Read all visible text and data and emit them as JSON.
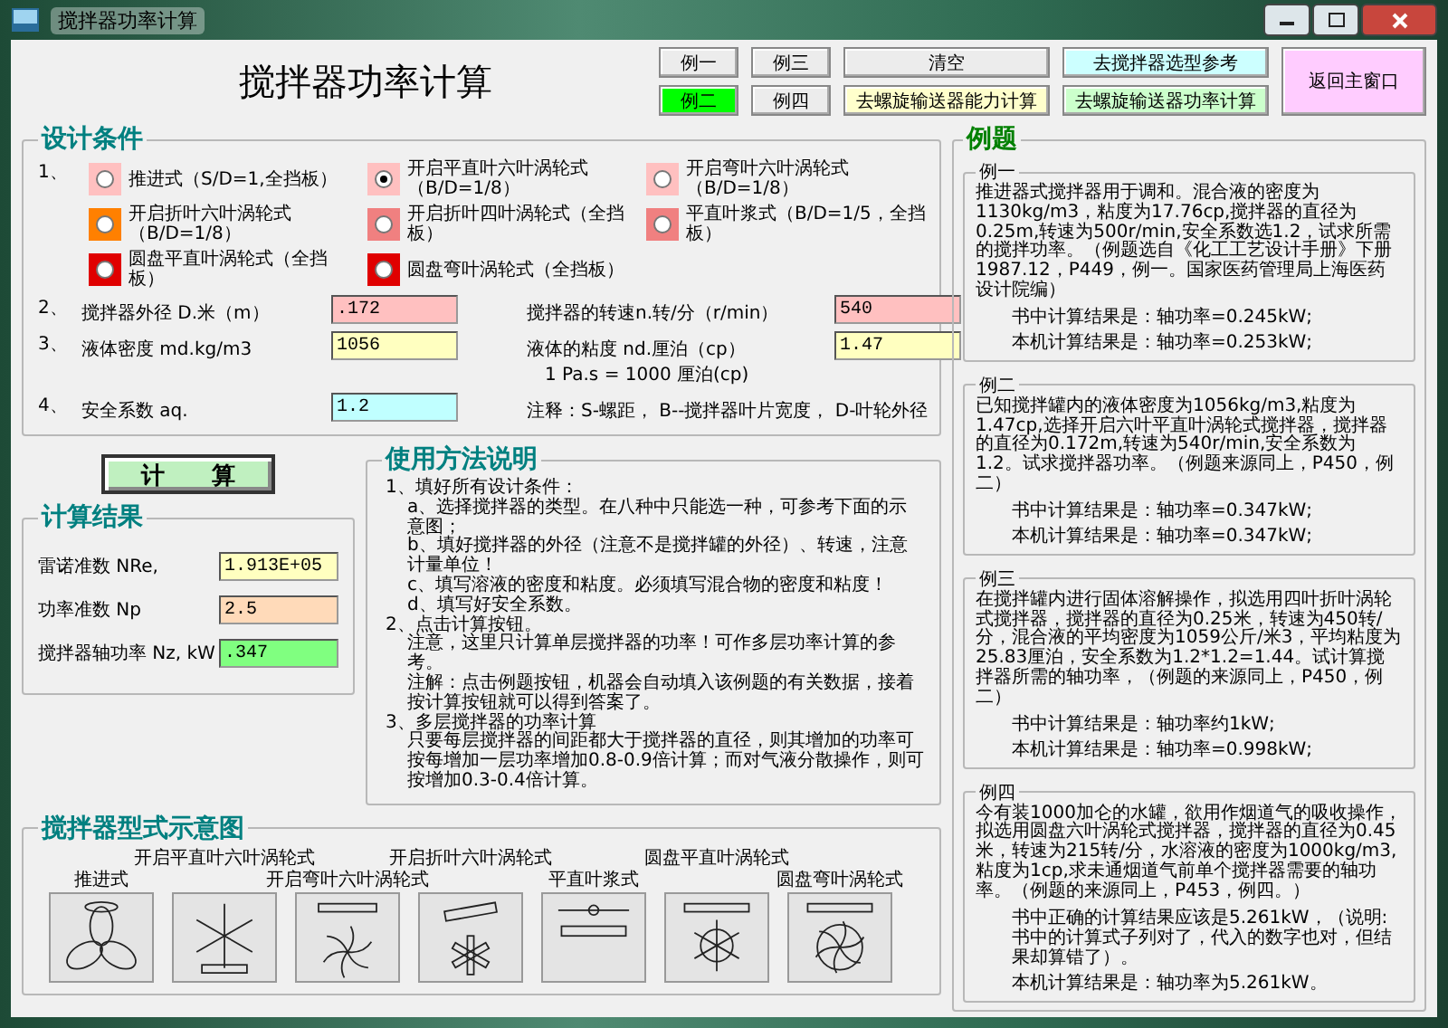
{
  "window": {
    "title": "搅拌器功率计算"
  },
  "heading": "搅拌器功率计算",
  "buttons": [
    {
      "label": "例一",
      "kind": "example",
      "selected": false
    },
    {
      "label": "例三",
      "kind": "example",
      "selected": false
    },
    {
      "label": "清空",
      "kind": "action"
    },
    {
      "label": "去搅拌器选型参考",
      "kind": "action",
      "color": "#ccffff"
    },
    {
      "label": "返回主窗口",
      "kind": "return",
      "color": "#ffccff"
    },
    {
      "label": "例二",
      "kind": "example",
      "selected": true
    },
    {
      "label": "例四",
      "kind": "example",
      "selected": false
    },
    {
      "label": "去螺旋输送器能力计算",
      "kind": "action",
      "color": "#ffffcc"
    },
    {
      "label": "去螺旋输送器功率计算",
      "kind": "action",
      "color": "#ccffcc"
    }
  ],
  "design": {
    "title": "设计条件",
    "type_number": "1、",
    "impeller_types": [
      {
        "label": "推进式（S/D=1,全挡板）",
        "selected": false,
        "color": "#ffc0c0"
      },
      {
        "label": "开启平直叶六叶涡轮式（B/D=1/8）",
        "selected": true,
        "color": "#ffc0c0"
      },
      {
        "label": "开启弯叶六叶涡轮式（B/D=1/8）",
        "selected": false,
        "color": "#ffc0c0"
      },
      {
        "label": "开启折叶六叶涡轮式（B/D=1/8）",
        "selected": false,
        "color": "#ff8000"
      },
      {
        "label": "开启折叶四叶涡轮式（全挡板）",
        "selected": false,
        "color": "#f08080"
      },
      {
        "label": "平直叶浆式（B/D=1/5，全挡板）",
        "selected": false,
        "color": "#f08080"
      },
      {
        "label": "圆盘平直叶涡轮式（全挡板）",
        "selected": false,
        "color": "#e00000"
      },
      {
        "label": "圆盘弯叶涡轮式（全挡板）",
        "selected": false,
        "color": "#e00000"
      }
    ],
    "rows": [
      {
        "number": "2、",
        "fields": [
          {
            "label": "搅拌器外径 D.米（m）",
            "value": ".172",
            "color": "#ffc0c0"
          },
          {
            "label": "搅拌器的转速n.转/分（r/min）",
            "value": "540",
            "color": "#ffc0c0"
          }
        ]
      },
      {
        "number": "3、",
        "fields": [
          {
            "label": "液体密度 md.kg/m3",
            "value": "1056",
            "color": "#ffffc0"
          },
          {
            "label": "液体的粘度 nd.厘泊（cp）",
            "note": "1 Pa.s = 1000 厘泊(cp)",
            "value": "1.47",
            "color": "#ffffc0"
          }
        ]
      },
      {
        "number": "4、",
        "fields": [
          {
            "label": "安全系数 aq.",
            "value": "1.2",
            "color": "#c0ffff"
          }
        ],
        "note": "注释：S-螺距， B--搅拌器叶片宽度， D-叶轮外径"
      }
    ]
  },
  "calculate_button": "计　　算",
  "results": {
    "title": "计算结果",
    "items": [
      {
        "label": "雷诺准数 NRe,",
        "value": "1.913E+05",
        "color": "#ffffc0"
      },
      {
        "label": "功率准数 Np",
        "value": "2.5",
        "color": "#ffdab9"
      },
      {
        "label": "搅拌器轴功率 Nz, kW",
        "value": ".347",
        "color": "#80ff80"
      }
    ]
  },
  "usage": {
    "title": "使用方法说明",
    "lines": [
      {
        "kind": "step",
        "text": "1、填好所有设计条件："
      },
      {
        "kind": "detail",
        "text": "a、选择搅拌器的类型。在八种中只能选一种，可参考下面的示意图；"
      },
      {
        "kind": "detail",
        "text": "b、填好搅拌器的外径（注意不是搅拌罐的外径）、转速，注意计量单位！"
      },
      {
        "kind": "detail",
        "text": "c、填写溶液的密度和粘度。必须填写混合物的密度和粘度！"
      },
      {
        "kind": "detail",
        "text": "d、填写好安全系数。"
      },
      {
        "kind": "step",
        "text": "2、点击计算按钮。"
      },
      {
        "kind": "detail",
        "text": "注意，这里只计算单层搅拌器的功率！可作多层功率计算的参考。"
      },
      {
        "kind": "detail",
        "text": "注解：点击例题按钮，机器会自动填入该例题的有关数据，接着按计算按钮就可以得到答案了。"
      },
      {
        "kind": "step",
        "text": "3、多层搅拌器的功率计算"
      },
      {
        "kind": "detail",
        "text": "只要每层搅拌器的间距都大于搅拌器的直径，则其增加的功率可按每增加一层功率增加0.8-0.9倍计算；而对气液分散操作，则可按增加0.3-0.4倍计算。"
      }
    ]
  },
  "diagrams": {
    "title": "搅拌器型式示意图",
    "items": [
      {
        "caption": "推进式",
        "kind": "propeller"
      },
      {
        "caption": "开启平直叶六叶涡轮式",
        "kind": "flat"
      },
      {
        "caption": "开启弯叶六叶涡轮式",
        "kind": "curved"
      },
      {
        "caption": "开启折叶六叶涡轮式",
        "kind": "pitched"
      },
      {
        "caption": "平直叶浆式",
        "kind": "paddle"
      },
      {
        "caption": "圆盘平直叶涡轮式",
        "kind": "disk_flat"
      },
      {
        "caption": "圆盘弯叶涡轮式",
        "kind": "disk_curved"
      }
    ]
  },
  "examples": {
    "title": "例题",
    "items": [
      {
        "title": "例一",
        "text": "推进器式搅拌器用于调和。混合液的密度为1130kg/m3，粘度为17.76cp,搅拌器的直径为0.25m,转速为500r/min,安全系数选1.2，试求所需的搅拌功率。（例题选自《化工工艺设计手册》下册 1987.12，P449，例一。国家医药管理局上海医药设计院编）",
        "results": [
          "书中计算结果是：轴功率=0.245kW;",
          "本机计算结果是：轴功率=0.253kW;"
        ]
      },
      {
        "title": "例二",
        "text": "已知搅拌罐内的液体密度为1056kg/m3,粘度为1.47cp,选择开启六叶平直叶涡轮式搅拌器，搅拌器的直径为0.172m,转速为540r/min,安全系数为1.2。试求搅拌器功率。（例题来源同上，P450，例二）",
        "results": [
          "书中计算结果是：轴功率=0.347kW;",
          "本机计算结果是：轴功率=0.347kW;"
        ]
      },
      {
        "title": "例三",
        "text": "在搅拌罐内进行固体溶解操作，拟选用四叶折叶涡轮式搅拌器，搅拌器的直径为0.25米，转速为450转/分，混合液的平均密度为1059公斤/米3，平均粘度为25.83厘泊，安全系数为1.2*1.2=1.44。试计算搅拌器所需的轴功率，（例题的来源同上，P450，例二）",
        "results": [
          "书中计算结果是：轴功率约1kW;",
          "本机计算结果是：轴功率=0.998kW;"
        ]
      },
      {
        "title": "例四",
        "text": "今有装1000加仑的水罐，欲用作烟道气的吸收操作，拟选用圆盘六叶涡轮式搅拌器，搅拌器的直径为0.45米，转速为215转/分，水溶液的密度为1000kg/m3,粘度为1cp,求未通烟道气前单个搅拌器需要的轴功率。（例题的来源同上，P453，例四。）",
        "results": [
          "书中正确的计算结果应该是5.261kW，（说明:书中的计算式子列对了，代入的数字也对，但结果却算错了）。",
          "本机计算结果是：轴功率为5.261kW。"
        ]
      }
    ]
  }
}
